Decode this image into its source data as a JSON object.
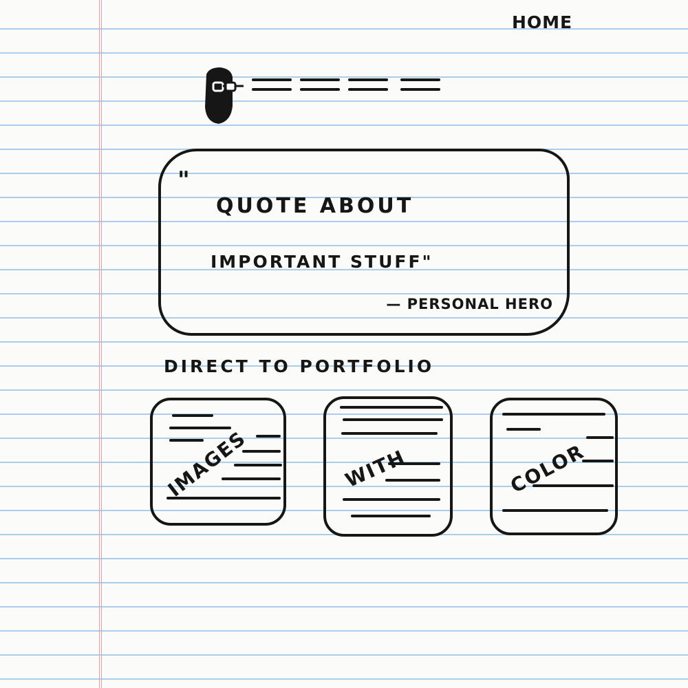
{
  "nav": {
    "page_label": "HOME",
    "link_count": 4
  },
  "hero_quote": {
    "open_mark": "\"",
    "line1": "QUOTE ABOUT",
    "line2": "IMPORTANT STUFF\"",
    "attribution": "— PERSONAL HERO"
  },
  "portfolio": {
    "heading": "DIRECT TO PORTFOLIO",
    "cards": [
      {
        "label": "IMAGES"
      },
      {
        "label": "WITH"
      },
      {
        "label": "COLOR"
      }
    ]
  },
  "icons": {
    "avatar": "bearded-face-with-glasses-icon"
  },
  "colors": {
    "ink": "#161616",
    "paper": "#fbfbfa",
    "rule_line": "#a9cdea",
    "margin_line": "#ee9ca4"
  }
}
